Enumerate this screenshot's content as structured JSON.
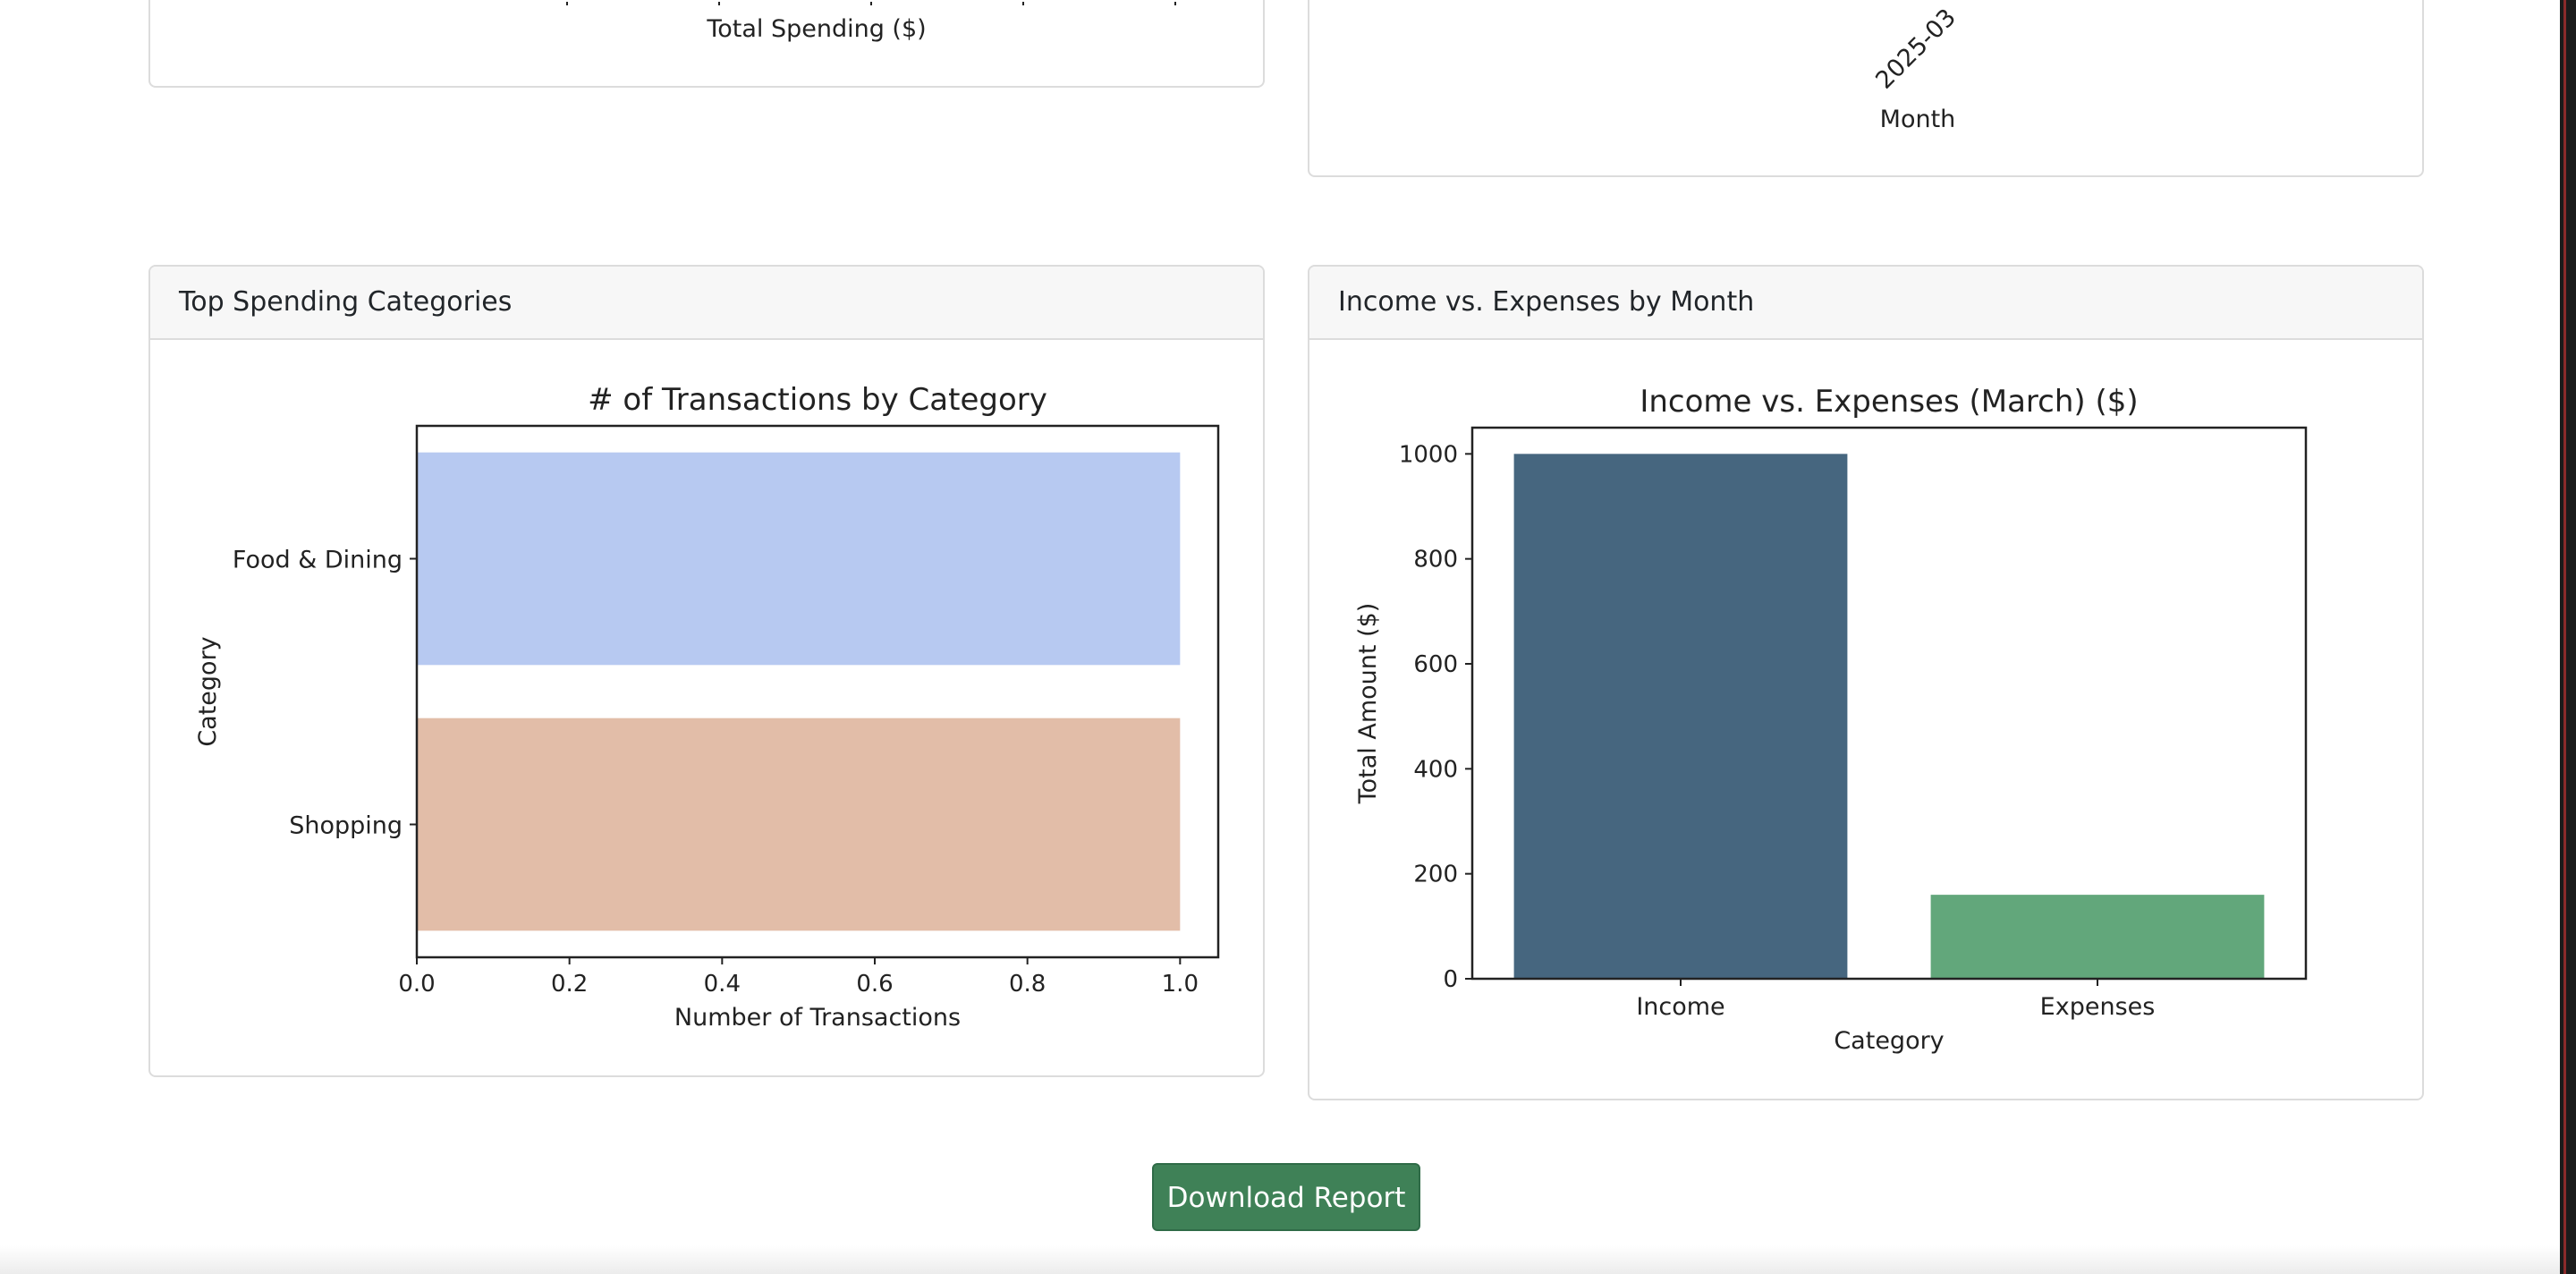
{
  "top_left_partial": {
    "xlabel": "Total Spending ($)"
  },
  "top_right_partial": {
    "tick_label": "2025-03",
    "xlabel": "Month"
  },
  "top_spending_card": {
    "header": "Top Spending Categories"
  },
  "income_card": {
    "header": "Income vs. Expenses by Month"
  },
  "chart_data": [
    {
      "type": "bar",
      "orientation": "horizontal",
      "title": "# of Transactions by Category",
      "xlabel": "Number of Transactions",
      "ylabel": "Category",
      "categories": [
        "Food & Dining",
        "Shopping"
      ],
      "values": [
        1,
        1
      ],
      "colors": [
        "#b7c9f1",
        "#e2bda8"
      ],
      "xlim": [
        0,
        1.05
      ],
      "xticks": [
        "0.0",
        "0.2",
        "0.4",
        "0.6",
        "0.8",
        "1.0"
      ],
      "grid": false,
      "legend": "none"
    },
    {
      "type": "bar",
      "title": "Income vs. Expenses (March) ($)",
      "xlabel": "Category",
      "ylabel": "Total Amount ($)",
      "categories": [
        "Income",
        "Expenses"
      ],
      "values": [
        1000,
        160
      ],
      "colors": [
        "#46667f",
        "#62a77b"
      ],
      "ylim": [
        0,
        1050
      ],
      "yticks": [
        "0",
        "200",
        "400",
        "600",
        "800",
        "1000"
      ],
      "grid": false,
      "legend": "none"
    }
  ],
  "actions": {
    "download_label": "Download Report"
  }
}
